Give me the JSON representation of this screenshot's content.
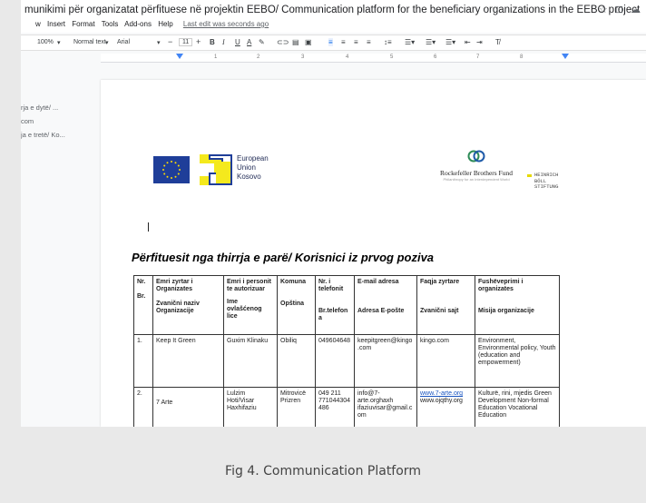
{
  "window": {
    "doc_title": "munikimi për organizatat përfituese në projektin EEBO/ Communication platform for the beneficiary organizations in the EEBO project",
    "title_icons": [
      "☆",
      "⊡",
      "☁"
    ]
  },
  "menu": {
    "items": [
      "w",
      "Insert",
      "Format",
      "Tools",
      "Add-ons",
      "Help"
    ],
    "last_edit": "Last edit was seconds ago"
  },
  "toolbar": {
    "zoom": "100%",
    "style": "Normal text",
    "font": "Arial",
    "font_size": "11",
    "bold": "B",
    "italic": "I",
    "underline": "U",
    "text_color": "A",
    "clear": "T̸"
  },
  "ruler": {
    "numbers": [
      "1",
      "2",
      "3",
      "4",
      "5",
      "6",
      "7",
      "8"
    ]
  },
  "outline": {
    "items": [
      "rja e dytë/ ...",
      "com",
      "ja e tretë/ Ko..."
    ]
  },
  "logos": {
    "eu_text": [
      "European",
      "Union",
      "Kosovo"
    ],
    "rbf_name": "Rockefeller Brothers Fund",
    "rbf_sub": "Philanthropy for an Interdependent World",
    "hbs_text": [
      "HEINRICH",
      "BÖLL",
      "STIFTUNG"
    ]
  },
  "document": {
    "heading": "Përfituesit nga thirrja e parë/ Korisnici iz prvog poziva"
  },
  "table": {
    "header": {
      "c1": [
        "Nr.",
        "Br."
      ],
      "c2": [
        "Emri zyrtar i Organizates",
        "Zvanični naziv Organizacije"
      ],
      "c3": [
        "Emri i personit te autorizuar",
        "Ime ovlašćenog lice"
      ],
      "c4": [
        "Komuna",
        "Opština"
      ],
      "c5": [
        "Nr. i telefonit",
        "Br.telefon a"
      ],
      "c6": [
        "E-mail adresa",
        "Adresa E-pošte"
      ],
      "c7": [
        "Faqja zyrtare",
        "Zvanični sajt"
      ],
      "c8": [
        "Fushëveprimi i organizates",
        "Misija organizacije"
      ]
    },
    "rows": [
      {
        "nr": "1.",
        "org": "Keep It Green",
        "person": "Guxim Klinaku",
        "komuna": "Obiliq",
        "phone": "049604648",
        "email": "keepitgreen@kingo .com",
        "web": "kingo.com",
        "mission": "Environment, Environmental policy, Youth (education and empowerment)"
      },
      {
        "nr": "2.",
        "org": "7 Arte",
        "person": "Lulzim Hoti/Visar Haxhifaziu",
        "komuna": "Mitrovicë Prizren",
        "phone": "049 211 771044304 486",
        "email": "info@7-arte.orghaxh ifaziuvisar@gmail.c om",
        "web_link": "www.7-arte.org",
        "web": "www.ojqthy.org",
        "mission": "Kulturë, rini, mjedis Green Development Non-formal Education Vocational Education"
      }
    ]
  },
  "caption": "Fig 4. Communication Platform"
}
